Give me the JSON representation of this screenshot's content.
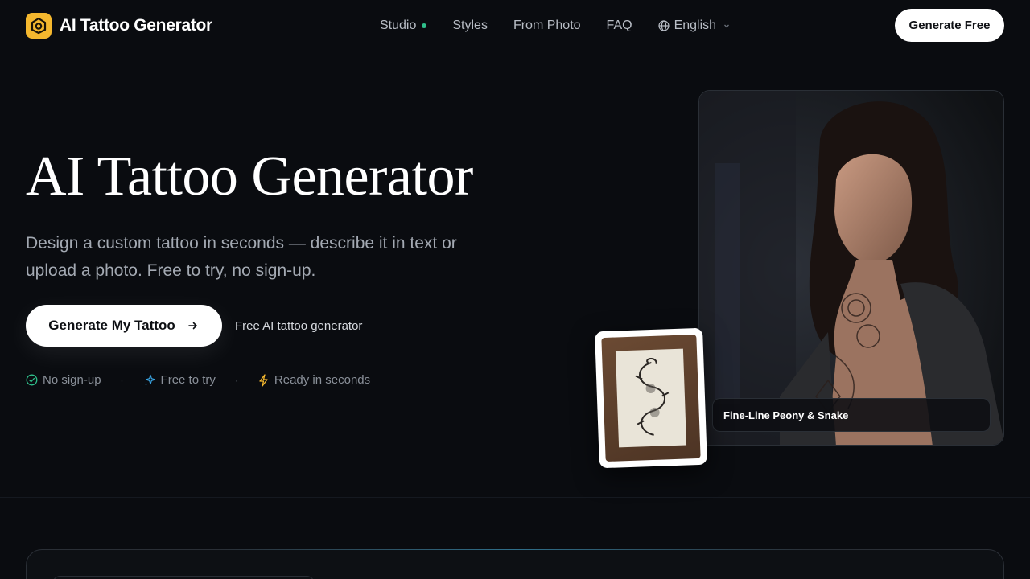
{
  "header": {
    "brand_name": "AI Tattoo Generator",
    "nav": [
      {
        "label": "Studio"
      },
      {
        "label": "Styles"
      },
      {
        "label": "From Photo"
      },
      {
        "label": "FAQ"
      }
    ],
    "language": "English",
    "cta_label": "Generate Free"
  },
  "hero": {
    "title": "AI Tattoo Generator",
    "subtitle": "Design a custom tattoo in seconds — describe it in text or upload a photo. Free to try, no sign-up.",
    "cta_label": "Generate My Tattoo",
    "cta_caption": "Free AI tattoo generator",
    "perks": [
      {
        "label": "No sign-up",
        "icon": "check-circle-icon",
        "color": "#2fbf8b"
      },
      {
        "label": "Free to try",
        "icon": "sparkle-icon",
        "color": "#3aa8e8"
      },
      {
        "label": "Ready in seconds",
        "icon": "lightning-icon",
        "color": "#f5b82e"
      }
    ]
  },
  "showcase": {
    "caption": "Fine-Line Peony & Snake"
  },
  "colors": {
    "background": "#0a0c10",
    "accent": "#f5b82e",
    "status_dot": "#2fbf8b"
  }
}
